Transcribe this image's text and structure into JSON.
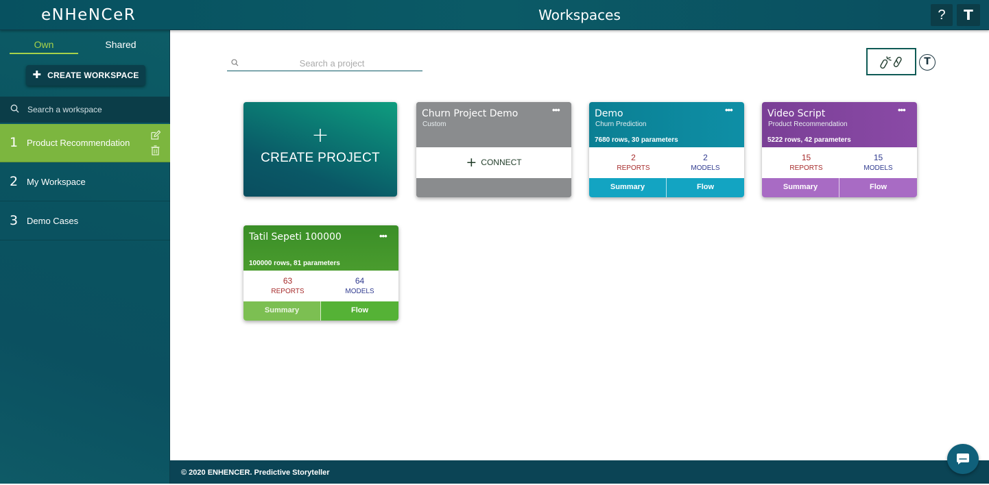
{
  "header": {
    "logo": "eNHeNCeR",
    "title": "Workspaces",
    "help_label": "?",
    "user_initial": "T"
  },
  "sidebar": {
    "tabs": {
      "own": "Own",
      "shared": "Shared"
    },
    "create_workspace_label": "CREATE WORKSPACE",
    "search_placeholder": "Search a workspace",
    "items": [
      {
        "number": "1",
        "label": "Product Recommendation",
        "active": true
      },
      {
        "number": "2",
        "label": "My Workspace",
        "active": false
      },
      {
        "number": "3",
        "label": "Demo Cases",
        "active": false
      }
    ]
  },
  "main": {
    "search_placeholder": "Search a project",
    "avatar_initial": "T",
    "create_project": {
      "plus": "+",
      "label": "CREATE PROJECT"
    },
    "projects": [
      {
        "title": "Churn Project Demo",
        "subtitle": "Custom",
        "connect_label": "CONNECT",
        "more": "•••"
      },
      {
        "title": "Demo",
        "subtitle": "Churn Prediction",
        "meta": "7680 rows, 30 parameters",
        "reports": "2",
        "reports_label": "REPORTS",
        "models": "2",
        "models_label": "MODELS",
        "summary_label": "Summary",
        "flow_label": "Flow",
        "more": "•••"
      },
      {
        "title": "Video Script",
        "subtitle": "Product Recommendation",
        "meta": "5222 rows, 42 parameters",
        "reports": "15",
        "reports_label": "REPORTS",
        "models": "15",
        "models_label": "MODELS",
        "summary_label": "Summary",
        "flow_label": "Flow",
        "more": "•••"
      },
      {
        "title": "Tatil Sepeti 100000",
        "subtitle": "",
        "meta": "100000 rows, 81 parameters",
        "reports": "63",
        "reports_label": "REPORTS",
        "models": "64",
        "models_label": "MODELS",
        "summary_label": "Summary",
        "flow_label": "Flow",
        "more": "•••"
      }
    ]
  },
  "footer": {
    "text": "© 2020 ENHENCER. Predictive Storyteller"
  },
  "colors": {
    "brand_teal": "#0a5360",
    "active_green": "#7cb63f",
    "demo_teal": "#0e8fa6",
    "video_purple": "#8a4aa6",
    "tatil_green": "#3f9a2a",
    "connect_gray": "#8a8c8e"
  },
  "icons": {
    "search": "search-icon",
    "edit": "edit-icon",
    "delete": "trash-icon",
    "link": "link-icon",
    "chat": "chat-icon"
  }
}
